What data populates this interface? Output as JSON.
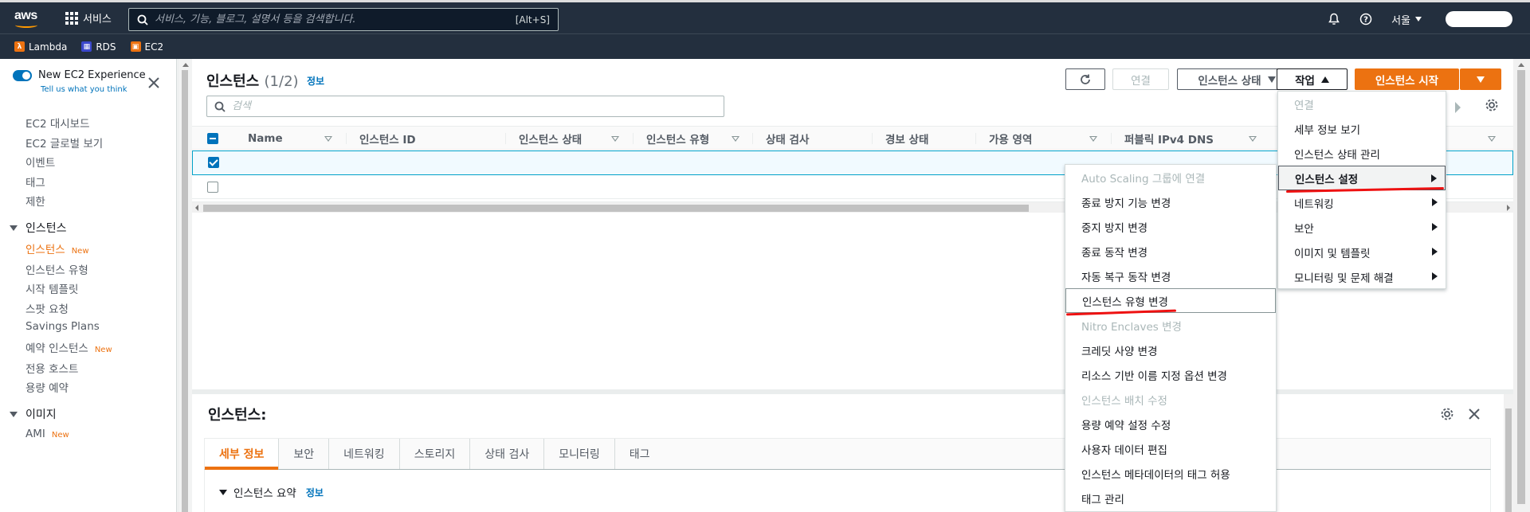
{
  "topnav": {
    "logo": "aws",
    "services_label": "서비스",
    "search_placeholder": "서비스, 기능, 블로그, 설명서 등을 검색합니다.",
    "search_shortcut": "[Alt+S]",
    "region": "서울"
  },
  "favorites": [
    {
      "label": "Lambda",
      "color": "#ec7211",
      "icon": "lambda-icon"
    },
    {
      "label": "RDS",
      "color": "#3b48cc",
      "icon": "rds-icon"
    },
    {
      "label": "EC2",
      "color": "#ec7211",
      "icon": "ec2-icon"
    }
  ],
  "sidebar": {
    "experience_title": "New EC2 Experience",
    "experience_sub": "Tell us what you think",
    "items": [
      {
        "label": "EC2 대시보드"
      },
      {
        "label": "EC2 글로벌 보기"
      },
      {
        "label": "이벤트"
      },
      {
        "label": "태그"
      },
      {
        "label": "제한"
      }
    ],
    "section_instances": "인스턴스",
    "instance_items": [
      {
        "label": "인스턴스",
        "badge": "New",
        "active": true
      },
      {
        "label": "인스턴스 유형"
      },
      {
        "label": "시작 템플릿"
      },
      {
        "label": "스팟 요청"
      },
      {
        "label": "Savings Plans"
      },
      {
        "label": "예약 인스턴스",
        "badge": "New"
      },
      {
        "label": "전용 호스트"
      },
      {
        "label": "용량 예약"
      }
    ],
    "section_images": "이미지",
    "image_items": [
      {
        "label": "AMI",
        "badge": "New"
      }
    ]
  },
  "main": {
    "title": "인스턴스",
    "count": "(1/2)",
    "info": "정보",
    "btn_connect": "연결",
    "btn_state": "인스턴스 상태",
    "btn_actions": "작업",
    "btn_launch": "인스턴스 시작",
    "search_placeholder": "검색",
    "columns": [
      "Name",
      "인스턴스 ID",
      "인스턴스 상태",
      "인스턴스 유형",
      "상태 검사",
      "경보 상태",
      "가용 영역",
      "퍼블릭 IPv4 DNS"
    ]
  },
  "actions_menu": {
    "items": [
      {
        "label": "연결",
        "disabled": true
      },
      {
        "label": "세부 정보 보기"
      },
      {
        "label": "인스턴스 상태 관리"
      },
      {
        "label": "인스턴스 설정",
        "submenu": true,
        "highlighted": true
      },
      {
        "label": "네트워킹",
        "submenu": true
      },
      {
        "label": "보안",
        "submenu": true
      },
      {
        "label": "이미지 및 템플릿",
        "submenu": true
      },
      {
        "label": "모니터링 및 문제 해결",
        "submenu": true
      }
    ]
  },
  "settings_submenu": {
    "items": [
      {
        "label": "Auto Scaling 그룹에 연결",
        "disabled": true
      },
      {
        "label": "종료 방지 기능 변경"
      },
      {
        "label": "중지 방지 변경"
      },
      {
        "label": "종료 동작 변경"
      },
      {
        "label": "자동 복구 동작 변경"
      },
      {
        "label": "인스턴스 유형 변경",
        "highlighted": true
      },
      {
        "label": "Nitro Enclaves 변경",
        "disabled": true
      },
      {
        "label": "크레딧 사양 변경"
      },
      {
        "label": "리소스 기반 이름 지정 옵션 변경"
      },
      {
        "label": "인스턴스 배치 수정",
        "disabled": true
      },
      {
        "label": "용량 예약 설정 수정"
      },
      {
        "label": "사용자 데이터 편집"
      },
      {
        "label": "인스턴스 메타데이터의 태그 허용"
      },
      {
        "label": "태그 관리"
      }
    ]
  },
  "details": {
    "title": "인스턴스:",
    "tabs": [
      "세부 정보",
      "보안",
      "네트워킹",
      "스토리지",
      "상태 검사",
      "모니터링",
      "태그"
    ],
    "summary": "인스턴스 요약",
    "summary_info": "정보"
  }
}
